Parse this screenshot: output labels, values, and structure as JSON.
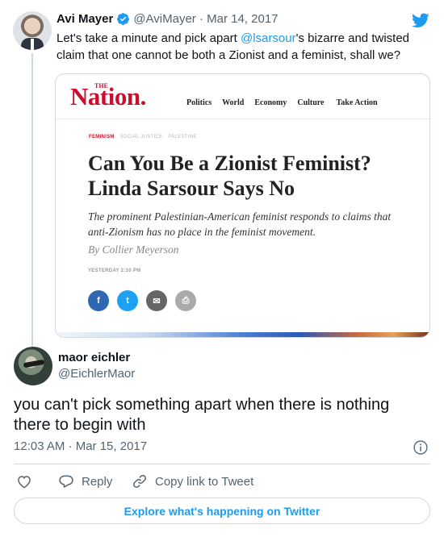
{
  "parent_tweet": {
    "author_name": "Avi Mayer",
    "handle_date": "@AviMayer · Mar 14, 2017",
    "text_before": "Let's take a minute and pick apart ",
    "mention": "@lsarsour",
    "text_after": "'s bizarre and twisted claim that one cannot be both a Zionist and a feminist, shall we?",
    "article": {
      "logo_the": "THE",
      "logo": "Nation.",
      "nav": [
        "Politics",
        "World",
        "Economy",
        "Culture",
        "Take Action"
      ],
      "tags": [
        "FEMINISM",
        "SOCIAL JUSTICE",
        "PALESTINE"
      ],
      "headline": "Can You Be a Zionist Feminist? Linda Sarsour Says No",
      "dek": "The prominent Palestinian-American feminist responds to claims that anti-Zionism has no place in the feminist movement.",
      "byline": "By Collier Meyerson",
      "dateline": "YESTERDAY 2:10 PM",
      "share_glyphs": {
        "facebook": "f",
        "twitter": "t",
        "email": "✉",
        "print": "⎙"
      }
    }
  },
  "reply_tweet": {
    "author_name": "maor eichler",
    "handle": "@EichlerMaor",
    "text": "you can't pick something apart when there is nothing there to begin with",
    "timestamp": "12:03 AM · Mar 15, 2017",
    "actions": {
      "reply": "Reply",
      "copy_link": "Copy link to Tweet"
    },
    "explore": "Explore what's happening on Twitter"
  },
  "colors": {
    "twitter_blue": "#1d9bf0",
    "nation_red": "#c8102e",
    "muted_text": "#536471"
  }
}
